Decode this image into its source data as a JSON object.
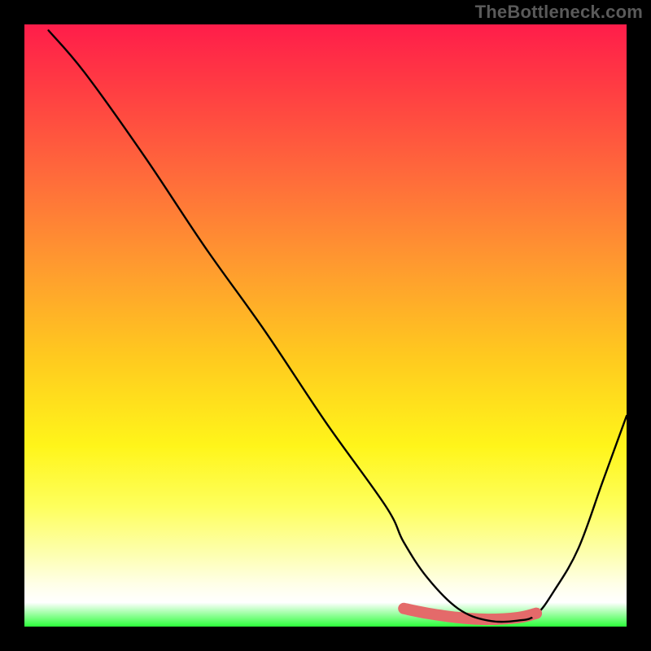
{
  "watermark": "TheBottleneck.com",
  "chart_data": {
    "type": "line",
    "title": "",
    "xlabel": "",
    "ylabel": "",
    "xlim": [
      0,
      100
    ],
    "ylim": [
      0,
      100
    ],
    "grid": false,
    "legend": false,
    "series": [
      {
        "name": "curve",
        "x": [
          4,
          10,
          20,
          30,
          40,
          50,
          60,
          63,
          67,
          72,
          77,
          82,
          85,
          88,
          92,
          96,
          100
        ],
        "values": [
          99,
          92,
          78,
          63,
          49,
          34,
          20,
          14,
          8,
          3,
          1,
          1,
          2,
          6,
          13,
          24,
          35
        ]
      }
    ],
    "optimal_band": {
      "x": [
        63,
        67,
        72,
        77,
        82,
        85
      ],
      "values": [
        3.0,
        2.2,
        1.5,
        1.2,
        1.5,
        2.2
      ]
    },
    "marker": {
      "x": 85,
      "y": 2.2
    },
    "colors": {
      "curve": "#000000",
      "band": "#e46a6a",
      "marker": "#e46a6a",
      "gradient_top": "#ff1d4a",
      "gradient_bottom": "#2cff3a"
    }
  }
}
